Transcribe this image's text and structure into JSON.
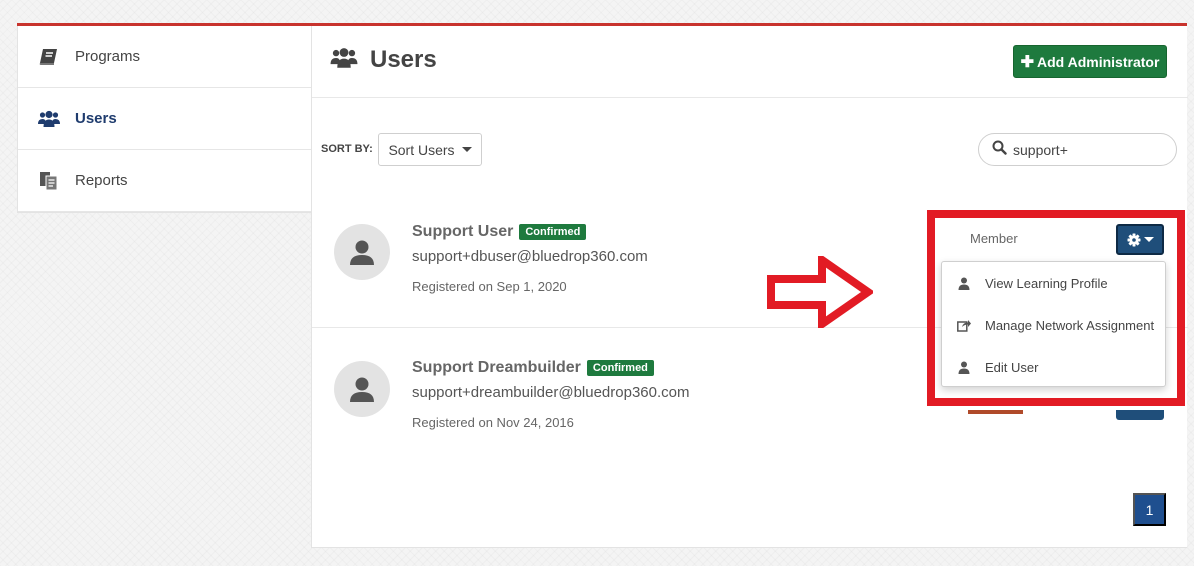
{
  "sidebar": {
    "items": [
      {
        "label": "Programs",
        "icon": "book-icon",
        "active": false
      },
      {
        "label": "Users",
        "icon": "users-icon",
        "active": true
      },
      {
        "label": "Reports",
        "icon": "reports-icon",
        "active": false
      }
    ]
  },
  "header": {
    "title": "Users",
    "add_admin_label": "Add Administrator"
  },
  "toolbar": {
    "sort_by_label": "SORT BY:",
    "sort_button_label": "Sort Users",
    "search_value": "support+"
  },
  "users": [
    {
      "name": "Support User",
      "status": "Confirmed",
      "email": "support+dbuser@bluedrop360.com",
      "registered": "Registered on Sep 1, 2020",
      "role": "Member"
    },
    {
      "name": "Support Dreambuilder",
      "status": "Confirmed",
      "email": "support+dreambuilder@bluedrop360.com",
      "registered": "Registered on Nov 24, 2016"
    }
  ],
  "actions_menu": {
    "items": [
      {
        "label": "View Learning Profile",
        "icon": "user-icon"
      },
      {
        "label": "Manage Network Assignment",
        "icon": "share-icon"
      },
      {
        "label": "Edit User",
        "icon": "user-icon"
      }
    ]
  },
  "pagination": {
    "current_page": "1"
  },
  "colors": {
    "accent_red": "#c8332d",
    "primary_green": "#1e7a3e",
    "primary_navy": "#1f4e7a",
    "annotation_red": "#e21b24"
  }
}
